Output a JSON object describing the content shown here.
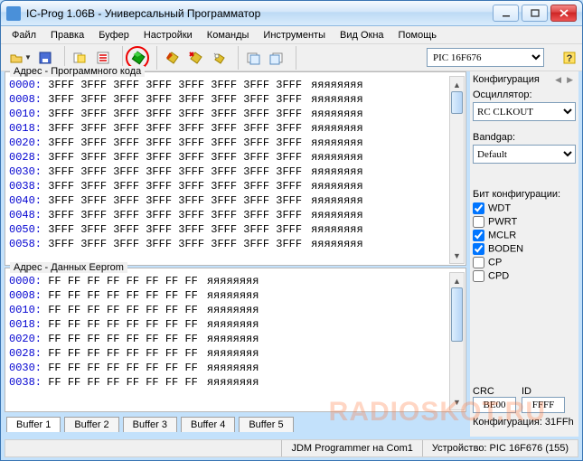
{
  "title": "IC-Prog 1.06B - Универсальный Программатор",
  "menubar": [
    "Файл",
    "Правка",
    "Буфер",
    "Настройки",
    "Команды",
    "Инструменты",
    "Вид Окна",
    "Помощь"
  ],
  "toolbar": {
    "buttons": [
      {
        "name": "open-icon",
        "sep": false,
        "drop": true
      },
      {
        "name": "save-icon",
        "sep": true,
        "drop": false
      },
      {
        "name": "config-icon",
        "sep": false,
        "drop": false
      },
      {
        "name": "options-icon",
        "sep": true,
        "drop": false
      },
      {
        "name": "read-chip-icon",
        "circled": true,
        "sep": true,
        "drop": false
      },
      {
        "name": "write-chip-icon",
        "sep": false,
        "drop": false
      },
      {
        "name": "erase-chip-icon",
        "sep": false,
        "drop": false
      },
      {
        "name": "verify-chip-icon",
        "sep": true,
        "drop": false
      },
      {
        "name": "buffer-a-icon",
        "sep": false,
        "drop": false
      },
      {
        "name": "buffer-b-icon",
        "sep": true,
        "drop": false
      }
    ],
    "device": "PIC 16F676"
  },
  "code": {
    "title": "Адрес - Программного кода",
    "rows": [
      {
        "addr": "0000:",
        "d": [
          "3FFF",
          "3FFF",
          "3FFF",
          "3FFF",
          "3FFF",
          "3FFF",
          "3FFF",
          "3FFF"
        ],
        "asc": "яяяяяяяя"
      },
      {
        "addr": "0008:",
        "d": [
          "3FFF",
          "3FFF",
          "3FFF",
          "3FFF",
          "3FFF",
          "3FFF",
          "3FFF",
          "3FFF"
        ],
        "asc": "яяяяяяяя"
      },
      {
        "addr": "0010:",
        "d": [
          "3FFF",
          "3FFF",
          "3FFF",
          "3FFF",
          "3FFF",
          "3FFF",
          "3FFF",
          "3FFF"
        ],
        "asc": "яяяяяяяя"
      },
      {
        "addr": "0018:",
        "d": [
          "3FFF",
          "3FFF",
          "3FFF",
          "3FFF",
          "3FFF",
          "3FFF",
          "3FFF",
          "3FFF"
        ],
        "asc": "яяяяяяяя"
      },
      {
        "addr": "0020:",
        "d": [
          "3FFF",
          "3FFF",
          "3FFF",
          "3FFF",
          "3FFF",
          "3FFF",
          "3FFF",
          "3FFF"
        ],
        "asc": "яяяяяяяя"
      },
      {
        "addr": "0028:",
        "d": [
          "3FFF",
          "3FFF",
          "3FFF",
          "3FFF",
          "3FFF",
          "3FFF",
          "3FFF",
          "3FFF"
        ],
        "asc": "яяяяяяяя"
      },
      {
        "addr": "0030:",
        "d": [
          "3FFF",
          "3FFF",
          "3FFF",
          "3FFF",
          "3FFF",
          "3FFF",
          "3FFF",
          "3FFF"
        ],
        "asc": "яяяяяяяя"
      },
      {
        "addr": "0038:",
        "d": [
          "3FFF",
          "3FFF",
          "3FFF",
          "3FFF",
          "3FFF",
          "3FFF",
          "3FFF",
          "3FFF"
        ],
        "asc": "яяяяяяяя"
      },
      {
        "addr": "0040:",
        "d": [
          "3FFF",
          "3FFF",
          "3FFF",
          "3FFF",
          "3FFF",
          "3FFF",
          "3FFF",
          "3FFF"
        ],
        "asc": "яяяяяяяя"
      },
      {
        "addr": "0048:",
        "d": [
          "3FFF",
          "3FFF",
          "3FFF",
          "3FFF",
          "3FFF",
          "3FFF",
          "3FFF",
          "3FFF"
        ],
        "asc": "яяяяяяяя"
      },
      {
        "addr": "0050:",
        "d": [
          "3FFF",
          "3FFF",
          "3FFF",
          "3FFF",
          "3FFF",
          "3FFF",
          "3FFF",
          "3FFF"
        ],
        "asc": "яяяяяяяя"
      },
      {
        "addr": "0058:",
        "d": [
          "3FFF",
          "3FFF",
          "3FFF",
          "3FFF",
          "3FFF",
          "3FFF",
          "3FFF",
          "3FFF"
        ],
        "asc": "яяяяяяяя"
      }
    ]
  },
  "eeprom": {
    "title": "Адрес - Данных Eeprom",
    "rows": [
      {
        "addr": "0000:",
        "d": [
          "FF",
          "FF",
          "FF",
          "FF",
          "FF",
          "FF",
          "FF",
          "FF"
        ],
        "asc": "яяяяяяяя"
      },
      {
        "addr": "0008:",
        "d": [
          "FF",
          "FF",
          "FF",
          "FF",
          "FF",
          "FF",
          "FF",
          "FF"
        ],
        "asc": "яяяяяяяя"
      },
      {
        "addr": "0010:",
        "d": [
          "FF",
          "FF",
          "FF",
          "FF",
          "FF",
          "FF",
          "FF",
          "FF"
        ],
        "asc": "яяяяяяяя"
      },
      {
        "addr": "0018:",
        "d": [
          "FF",
          "FF",
          "FF",
          "FF",
          "FF",
          "FF",
          "FF",
          "FF"
        ],
        "asc": "яяяяяяяя"
      },
      {
        "addr": "0020:",
        "d": [
          "FF",
          "FF",
          "FF",
          "FF",
          "FF",
          "FF",
          "FF",
          "FF"
        ],
        "asc": "яяяяяяяя"
      },
      {
        "addr": "0028:",
        "d": [
          "FF",
          "FF",
          "FF",
          "FF",
          "FF",
          "FF",
          "FF",
          "FF"
        ],
        "asc": "яяяяяяяя"
      },
      {
        "addr": "0030:",
        "d": [
          "FF",
          "FF",
          "FF",
          "FF",
          "FF",
          "FF",
          "FF",
          "FF"
        ],
        "asc": "яяяяяяяя"
      },
      {
        "addr": "0038:",
        "d": [
          "FF",
          "FF",
          "FF",
          "FF",
          "FF",
          "FF",
          "FF",
          "FF"
        ],
        "asc": "яяяяяяяя"
      }
    ]
  },
  "tabs": [
    "Buffer 1",
    "Buffer 2",
    "Buffer 3",
    "Buffer 4",
    "Buffer 5"
  ],
  "config": {
    "title": "Конфигурация",
    "osc_label": "Осциллятор:",
    "osc_value": "RC CLKOUT",
    "bandgap_label": "Bandgap:",
    "bandgap_value": "Default",
    "bits_label": "Бит конфигурации:",
    "bits": [
      {
        "label": "WDT",
        "checked": true
      },
      {
        "label": "PWRT",
        "checked": false
      },
      {
        "label": "MCLR",
        "checked": true
      },
      {
        "label": "BODEN",
        "checked": true
      },
      {
        "label": "CP",
        "checked": false
      },
      {
        "label": "CPD",
        "checked": false
      }
    ],
    "crc_label": "CRC",
    "crc_value": "BE00",
    "id_label": "ID",
    "id_value": "FFFF",
    "cfg_value": "Конфигурация: 31FFh"
  },
  "status": {
    "programmer": "JDM Programmer на Com1",
    "device": "Устройство: PIC 16F676   (155)"
  },
  "watermark": "RADIOSKOT.RU"
}
